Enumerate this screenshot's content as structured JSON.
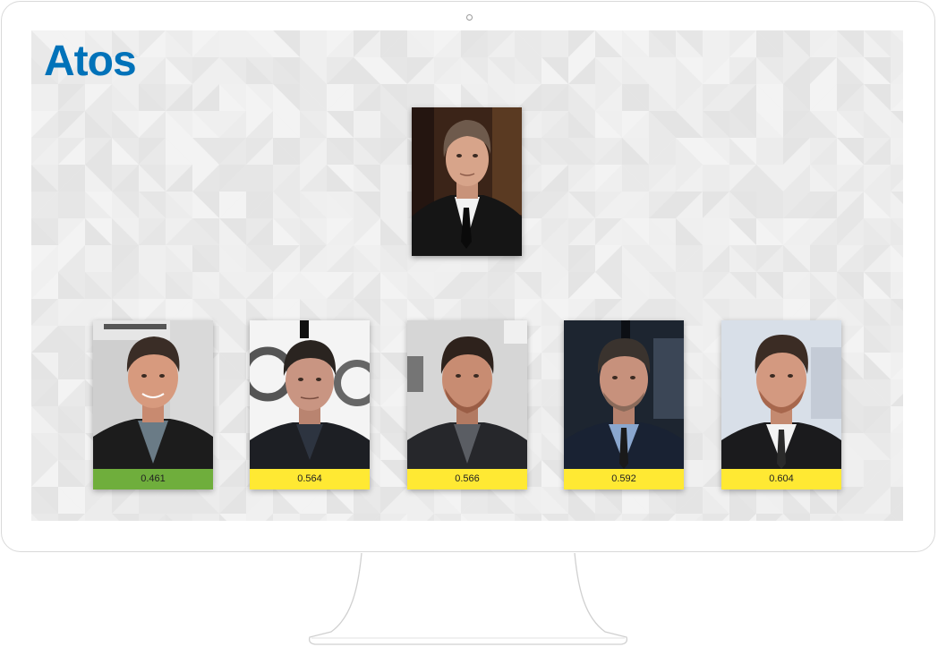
{
  "logo": {
    "text": "Atos",
    "color": "#0072b9"
  },
  "probe": {
    "icon": "portrait-photo"
  },
  "matches": [
    {
      "score": "0.461",
      "status": "best-match",
      "color": "#6fae3c"
    },
    {
      "score": "0.564",
      "status": "candidate",
      "color": "#ffe933"
    },
    {
      "score": "0.566",
      "status": "candidate",
      "color": "#ffe933"
    },
    {
      "score": "0.592",
      "status": "candidate",
      "color": "#ffe933"
    },
    {
      "score": "0.604",
      "status": "candidate",
      "color": "#ffe933"
    }
  ],
  "colors": {
    "screen_background": "#ececec",
    "monitor_frame": "#d9d9d9"
  }
}
